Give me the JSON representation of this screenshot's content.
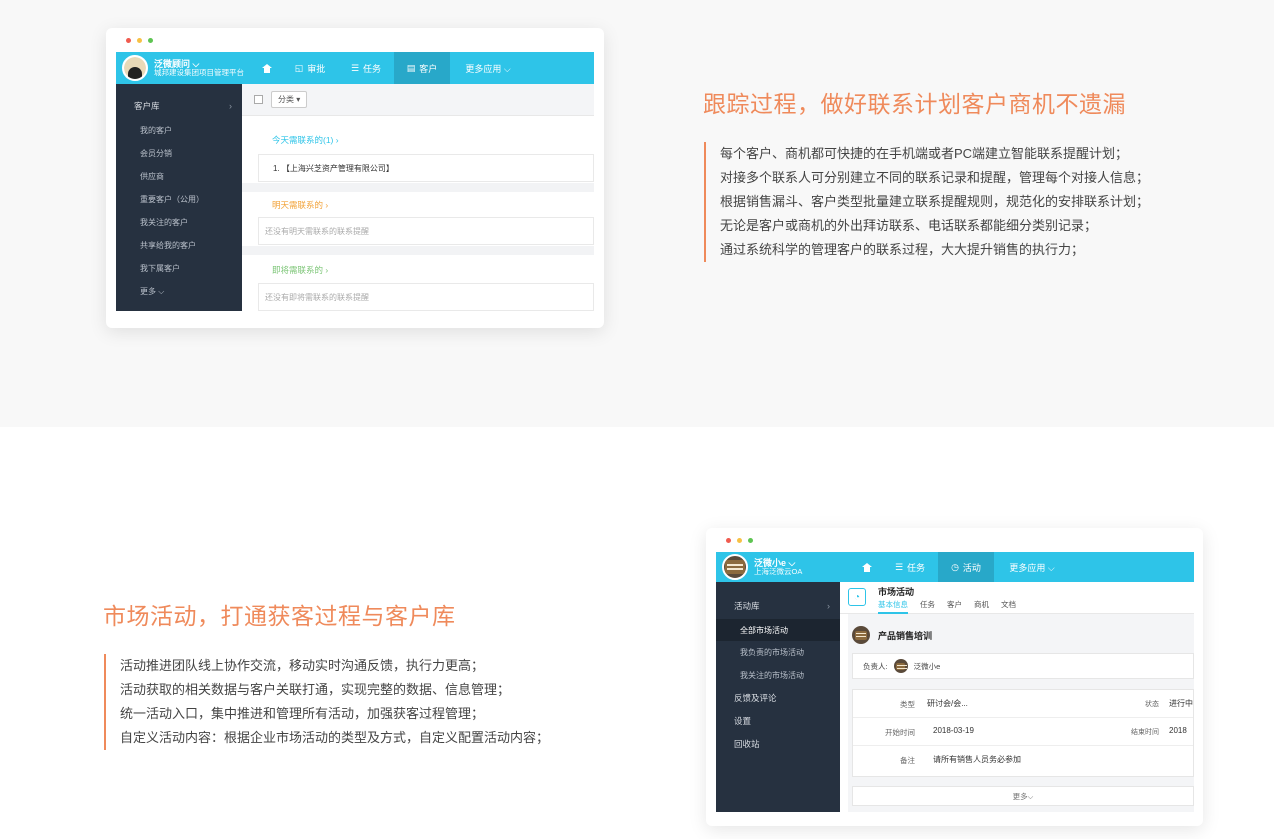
{
  "section1": {
    "heading": "跟踪过程，做好联系计划客户商机不遗漏",
    "lines": [
      "每个客户、商机都可快捷的在手机端或者PC端建立智能联系提醒计划；",
      "对接多个联系人可分别建立不同的联系记录和提醒，管理每个对接人信息；",
      "根据销售漏斗、客户类型批量建立联系提醒规则，规范化的安排联系计划；",
      "无论是客户或商机的外出拜访联系、电话联系都能细分类别记录；",
      "通过系统科学的管理客户的联系过程，大大提升销售的执行力；"
    ]
  },
  "section2": {
    "heading": "市场活动，打通获客过程与客户库",
    "lines": [
      "活动推进团队线上协作交流，移动实时沟通反馈，执行力更高；",
      "活动获取的相关数据与客户关联打通，实现完整的数据、信息管理；",
      "统一活动入口，集中推进和管理所有活动，加强获客过程管理；",
      "自定义活动内容：根据企业市场活动的类型及方式，自定义配置活动内容；"
    ]
  },
  "card1": {
    "user_name": "泛微顾问 ⌵",
    "org_name": "城邦建设集团项目管理平台",
    "nav": {
      "approval": "审批",
      "task": "任务",
      "customer": "客户",
      "more": "更多应用 ⌵"
    },
    "sidebar": {
      "head": "客户库",
      "items": [
        "我的客户",
        "会员分销",
        "供应商",
        "重要客户（公用）",
        "我关注的客户",
        "共享给我的客户",
        "我下属客户",
        "更多 ⌵"
      ]
    },
    "toolbar": {
      "filter": "分类 ▾"
    },
    "groups": [
      {
        "title": "今天需联系的(1)  ›",
        "color": "#2ec4e8"
      },
      {
        "title": "明天需联系的  ›",
        "color": "#f2a33a"
      },
      {
        "title": "即将需联系的  ›",
        "color": "#7cc576"
      }
    ],
    "today_row": "1.    【上海兴芝资产管理有限公司】",
    "tomorrow_empty": "还没有明天需联系的联系提醒",
    "soon_empty": "还没有即将需联系的联系提醒"
  },
  "card2": {
    "user_name": "泛微小e ⌵",
    "org_name": "上海泛微云OA",
    "nav": {
      "task": "任务",
      "activity": "活动",
      "more": "更多应用 ⌵"
    },
    "sidebar": {
      "head": "活动库",
      "items": [
        "全部市场活动",
        "我负责的市场活动",
        "我关注的市场活动"
      ],
      "heads2": [
        "反馈及评论",
        "设置",
        "回收站"
      ]
    },
    "title": "市场活动",
    "tabs": [
      "基本信息",
      "任务",
      "客户",
      "商机",
      "文档"
    ],
    "event_name": "产品销售培训",
    "owner_label": "负责人:",
    "owner_name": "泛微小e",
    "rows": {
      "type_label": "类型",
      "type_value": "研讨会/会...",
      "status_label": "状态",
      "status_value": "进行中",
      "start_label": "开始时间",
      "start_value": "2018-03-19",
      "end_label": "结束时间",
      "end_value": "2018",
      "note_label": "备注",
      "note_value": "请所有销售人员务必参加"
    },
    "more": "更多⌵"
  },
  "colors": {
    "accent_orange": "#ef8a5b",
    "topbar_blue": "#2ec4e8",
    "sidebar_dark": "#263140"
  }
}
